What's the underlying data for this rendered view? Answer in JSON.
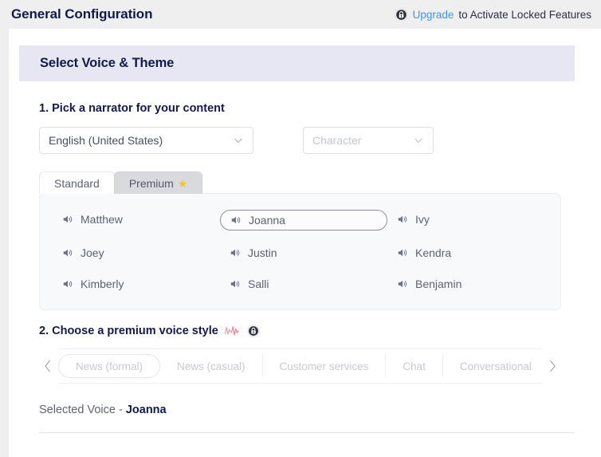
{
  "topbar": {
    "title": "General Configuration",
    "lock_icon": "lock-badge-icon",
    "upgrade_link": "Upgrade",
    "upgrade_rest": "to Activate Locked Features",
    "link_color": "#3a97f5"
  },
  "section": {
    "header_title": "Select Voice & Theme",
    "header_bg": "#e6e7f2"
  },
  "step1": {
    "label": "1. Pick a narrator for your content",
    "language_select": {
      "value": "English (United States)",
      "icon": "chevron-down-icon"
    },
    "character_select": {
      "placeholder": "Character",
      "value": "Character",
      "icon": "chevron-down-icon"
    }
  },
  "tabs": [
    {
      "label": "Standard",
      "active": false,
      "star": false
    },
    {
      "label": "Premium",
      "active": true,
      "star": true,
      "star_glyph": "★",
      "star_color": "#f9c22b"
    }
  ],
  "voices": [
    {
      "name": "Matthew",
      "selected": false
    },
    {
      "name": "Joanna",
      "selected": true
    },
    {
      "name": "Ivy",
      "selected": false
    },
    {
      "name": "Joey",
      "selected": false
    },
    {
      "name": "Justin",
      "selected": false
    },
    {
      "name": "Kendra",
      "selected": false
    },
    {
      "name": "Kimberly",
      "selected": false
    },
    {
      "name": "Salli",
      "selected": false
    },
    {
      "name": "Benjamin",
      "selected": false
    }
  ],
  "voice_icon": "speaker-icon",
  "step2": {
    "label": "2. Choose a premium voice style",
    "wave_icon": "audio-waveform-icon",
    "wave_color": "#f08a9b",
    "lock_icon": "lock-badge-icon"
  },
  "carousel": {
    "prev_icon": "chevron-left-icon",
    "next_icon": "chevron-right-icon",
    "chips": [
      "News (formal)",
      "News (casual)",
      "Customer services",
      "Chat",
      "Conversational"
    ]
  },
  "selected_voice": {
    "prefix": "Selected Voice - ",
    "name": "Joanna"
  }
}
